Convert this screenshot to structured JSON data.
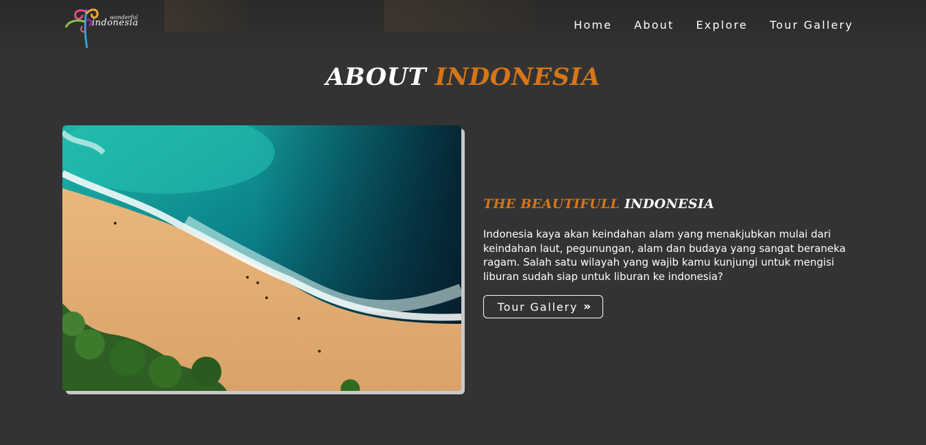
{
  "brand": {
    "small": "wonderful",
    "big": "indonesia"
  },
  "nav": {
    "items": [
      {
        "label": "Home"
      },
      {
        "label": "About"
      },
      {
        "label": "Explore"
      },
      {
        "label": "Tour Gallery"
      }
    ]
  },
  "section": {
    "title_main": "ABOUT",
    "title_accent": "INDONESIA",
    "subtitle_accent": "THE BEAUTIFULL",
    "subtitle_main": "INDONESIA",
    "description": "Indonesia kaya akan keindahan alam yang menakjubkan mulai dari keindahan laut, pegunungan, alam dan budaya yang sangat beraneka ragam. Salah satu wilayah yang wajib kamu kunjungi untuk mengisi liburan sudah siap untuk liburan ke indonesia?",
    "button_label": "Tour Gallery",
    "button_icon": "double-chevron-right-icon"
  },
  "colors": {
    "background": "#333333",
    "accent": "#d4761a",
    "text": "#ffffff"
  }
}
